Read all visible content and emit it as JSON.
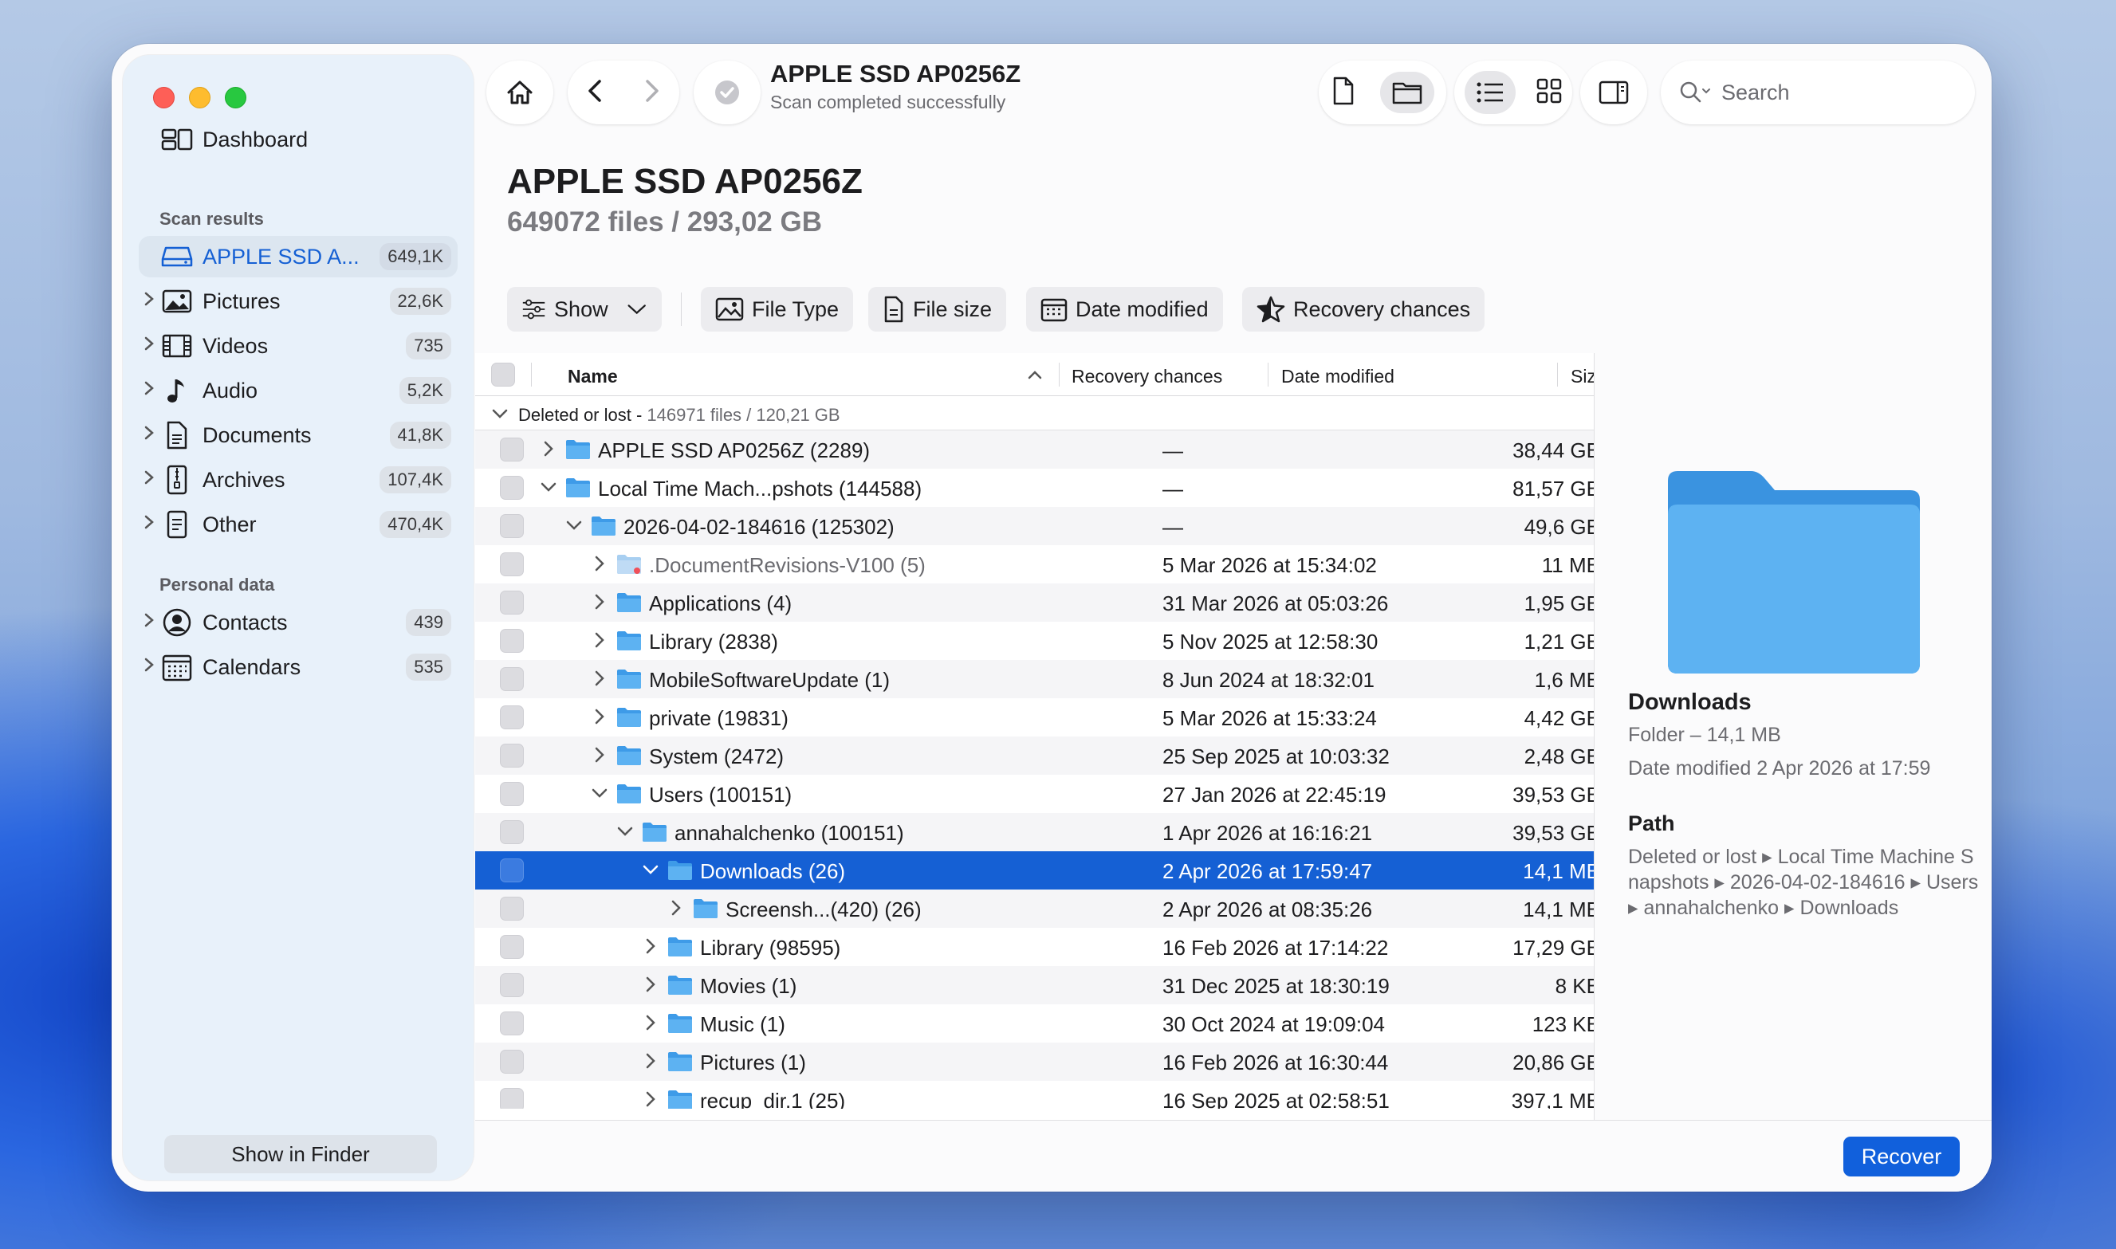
{
  "sidebar": {
    "dashboard": "Dashboard",
    "scan_results_heading": "Scan results",
    "scan_items": [
      {
        "label": "APPLE SSD A...",
        "count": "649,1K",
        "icon": "drive-icon",
        "selected": true
      },
      {
        "label": "Pictures",
        "count": "22,6K",
        "icon": "picture-icon"
      },
      {
        "label": "Videos",
        "count": "735",
        "icon": "film-icon"
      },
      {
        "label": "Audio",
        "count": "5,2K",
        "icon": "music-note-icon"
      },
      {
        "label": "Documents",
        "count": "41,8K",
        "icon": "document-icon"
      },
      {
        "label": "Archives",
        "count": "107,4K",
        "icon": "archive-icon"
      },
      {
        "label": "Other",
        "count": "470,4K",
        "icon": "other-file-icon"
      }
    ],
    "personal_heading": "Personal data",
    "personal_items": [
      {
        "label": "Contacts",
        "count": "439",
        "icon": "contact-icon"
      },
      {
        "label": "Calendars",
        "count": "535",
        "icon": "calendar-icon"
      }
    ],
    "show_in_finder": "Show in Finder"
  },
  "toolbar": {
    "title": "APPLE SSD AP0256Z",
    "subtitle": "Scan completed successfully",
    "search_placeholder": "Search"
  },
  "header": {
    "title": "APPLE SSD AP0256Z",
    "subtitle": "649072 files / 293,02 GB"
  },
  "filters": {
    "show": "Show",
    "file_type": "File Type",
    "file_size": "File size",
    "date_modified": "Date modified",
    "recovery_chances": "Recovery chances"
  },
  "table": {
    "columns": {
      "name": "Name",
      "recovery": "Recovery chances",
      "date": "Date modified",
      "size": "Size"
    },
    "group_label": "Deleted or lost - ",
    "group_meta": "146971 files / 120,21 GB",
    "rows": [
      {
        "name": "APPLE SSD AP0256Z (2289)",
        "date": "—",
        "size": "38,44 GB",
        "depth": 0,
        "expanded": false
      },
      {
        "name": "Local Time Mach...pshots (144588)",
        "date": "—",
        "size": "81,57 GB",
        "depth": 0,
        "expanded": true
      },
      {
        "name": "2026-04-02-184616 (125302)",
        "date": "—",
        "size": "49,6 GB",
        "depth": 1,
        "expanded": true
      },
      {
        "name": ".DocumentRevisions-V100 (5)",
        "date": "5 Mar 2026 at 15:34:02",
        "size": "11 MB",
        "depth": 2,
        "expanded": false,
        "dim": true
      },
      {
        "name": "Applications (4)",
        "date": "31 Mar 2026 at 05:03:26",
        "size": "1,95 GB",
        "depth": 2,
        "expanded": false
      },
      {
        "name": "Library (2838)",
        "date": "5 Nov 2025 at 12:58:30",
        "size": "1,21 GB",
        "depth": 2,
        "expanded": false
      },
      {
        "name": "MobileSoftwareUpdate (1)",
        "date": "8 Jun 2024 at 18:32:01",
        "size": "1,6 MB",
        "depth": 2,
        "expanded": false
      },
      {
        "name": "private (19831)",
        "date": "5 Mar 2026 at 15:33:24",
        "size": "4,42 GB",
        "depth": 2,
        "expanded": false
      },
      {
        "name": "System (2472)",
        "date": "25 Sep 2025 at 10:03:32",
        "size": "2,48 GB",
        "depth": 2,
        "expanded": false
      },
      {
        "name": "Users (100151)",
        "date": "27 Jan 2026 at 22:45:19",
        "size": "39,53 GB",
        "depth": 2,
        "expanded": true
      },
      {
        "name": "annahalchenko (100151)",
        "date": "1 Apr 2026 at 16:16:21",
        "size": "39,53 GB",
        "depth": 3,
        "expanded": true
      },
      {
        "name": "Downloads (26)",
        "date": "2 Apr 2026 at 17:59:47",
        "size": "14,1 MB",
        "depth": 4,
        "expanded": true,
        "selected": true
      },
      {
        "name": "Screensh...(420) (26)",
        "date": "2 Apr 2026 at 08:35:26",
        "size": "14,1 MB",
        "depth": 5,
        "expanded": false
      },
      {
        "name": "Library (98595)",
        "date": "16 Feb 2026 at 17:14:22",
        "size": "17,29 GB",
        "depth": 4,
        "expanded": false
      },
      {
        "name": "Movies (1)",
        "date": "31 Dec 2025 at 18:30:19",
        "size": "8 KB",
        "depth": 4,
        "expanded": false
      },
      {
        "name": "Music (1)",
        "date": "30 Oct 2024 at 19:09:04",
        "size": "123 KB",
        "depth": 4,
        "expanded": false
      },
      {
        "name": "Pictures (1)",
        "date": "16 Feb 2026 at 16:30:44",
        "size": "20,86 GB",
        "depth": 4,
        "expanded": false
      },
      {
        "name": "recup_dir.1 (25)",
        "date": "16 Sep 2025 at 02:58:51",
        "size": "397,1 MB",
        "depth": 4,
        "expanded": false
      }
    ]
  },
  "preview": {
    "name": "Downloads",
    "kind": "Folder – 14,1 MB",
    "date_label": "Date modified",
    "date_value": "2 Apr 2026 at 17:59",
    "path_heading": "Path",
    "path": "Deleted or lost ▸ Local Time Machine Snapshots ▸ 2026-04-02-184616 ▸ Users ▸ annahalchenko ▸ Downloads"
  },
  "actions": {
    "recover": "Recover"
  },
  "colors": {
    "accent": "#1560d4",
    "folder": "#3e9be8"
  }
}
